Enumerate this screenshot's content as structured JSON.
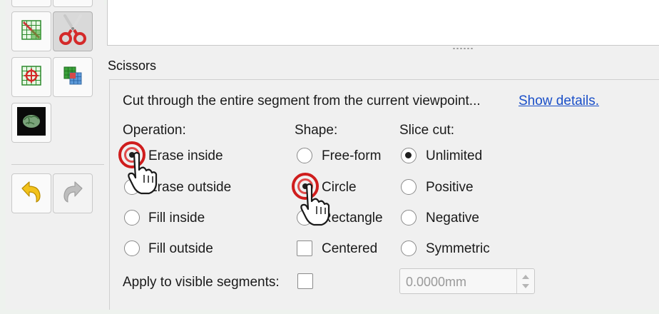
{
  "effect": {
    "title": "Scissors",
    "description": "Cut through the entire segment from the current viewpoint...",
    "show_details_link": "Show details."
  },
  "operation": {
    "label": "Operation:",
    "options": [
      {
        "label": "Erase inside",
        "checked": true
      },
      {
        "label": "Erase outside",
        "checked": false
      },
      {
        "label": "Fill inside",
        "checked": false
      },
      {
        "label": "Fill outside",
        "checked": false
      }
    ]
  },
  "shape": {
    "label": "Shape:",
    "options": [
      {
        "label": "Free-form",
        "checked": false
      },
      {
        "label": "Circle",
        "checked": true
      },
      {
        "label": "Rectangle",
        "checked": false
      }
    ],
    "centered_label": "Centered",
    "centered_checked": false
  },
  "slice_cut": {
    "label": "Slice cut:",
    "options": [
      {
        "label": "Unlimited",
        "checked": true
      },
      {
        "label": "Positive",
        "checked": false
      },
      {
        "label": "Negative",
        "checked": false
      },
      {
        "label": "Symmetric",
        "checked": false
      }
    ],
    "thickness_value": "0.0000mm"
  },
  "apply_visible": {
    "label": "Apply to visible segments:",
    "checked": false
  },
  "tools": [
    {
      "icon": "paint-grid-icon",
      "active": false
    },
    {
      "icon": "scissors-icon",
      "active": true
    },
    {
      "icon": "target-grid-icon",
      "active": false
    },
    {
      "icon": "logical-operators-icon",
      "active": false
    },
    {
      "icon": "brain-icon",
      "active": false
    },
    {
      "icon": "undo-icon",
      "active": false
    },
    {
      "icon": "redo-icon",
      "active": false,
      "disabled": true
    }
  ],
  "colors": {
    "scissors_red": "#d42a2a",
    "link_blue": "#1a4fc8",
    "click_ring": "#cf1d1d",
    "undo_yellow": "#f2c21b"
  }
}
